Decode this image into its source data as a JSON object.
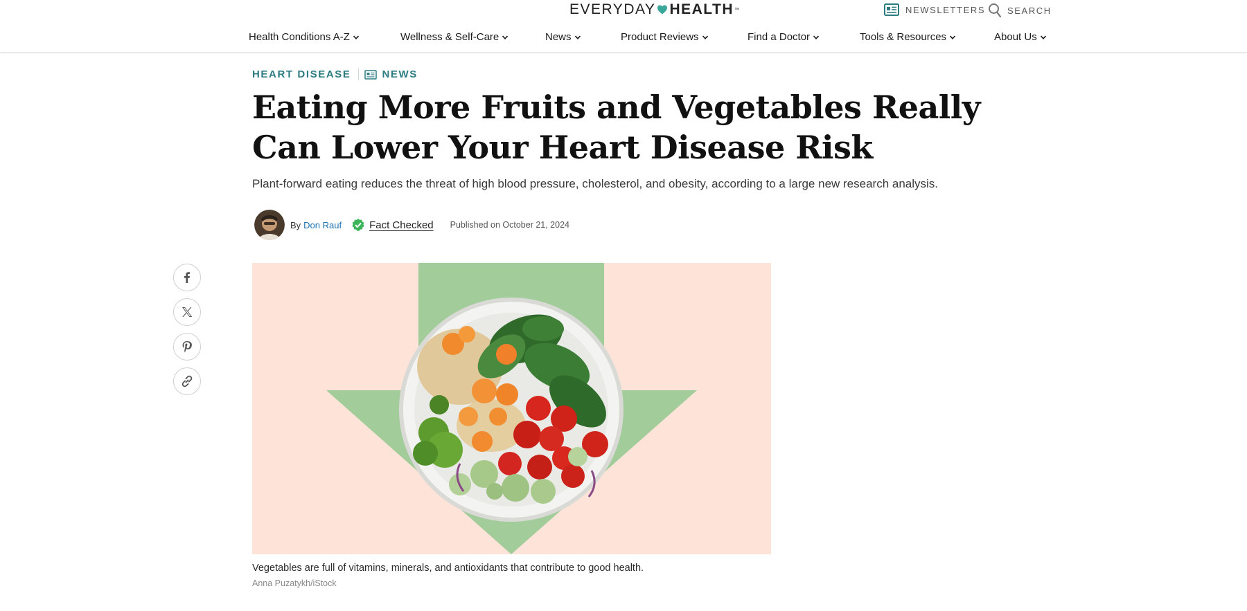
{
  "header": {
    "logo": {
      "part1": "EVERYDAY",
      "part2": "HEALTH",
      "tm": "™"
    },
    "newsletters_label": "NEWSLETTERS",
    "search_label": "SEARCH"
  },
  "nav": {
    "items": [
      {
        "label": "Health Conditions A-Z"
      },
      {
        "label": "Wellness & Self-Care"
      },
      {
        "label": "News"
      },
      {
        "label": "Product Reviews"
      },
      {
        "label": "Find a Doctor"
      },
      {
        "label": "Tools & Resources"
      },
      {
        "label": "About Us"
      }
    ]
  },
  "article": {
    "category": "HEART DISEASE",
    "type": "NEWS",
    "headline": "Eating More Fruits and Vegetables Really Can Lower Your Heart Disease Risk",
    "dek": "Plant-forward eating reduces the threat of high blood pressure, cholesterol, and obesity, according to a large new research analysis.",
    "byline_prefix": "By",
    "author": "Don Rauf",
    "fact_checked": "Fact Checked",
    "published": "Published on October 21, 2024",
    "image_caption": "Vegetables are full of vitamins, minerals, and antioxidants that contribute to good health.",
    "image_credit": "Anna Puzatykh/iStock"
  },
  "share": [
    "facebook-icon",
    "x-icon",
    "pinterest-icon",
    "link-icon"
  ],
  "colors": {
    "accent_teal": "#2c7b80",
    "link_blue": "#1c6fb0",
    "hero_background": "#fde3d8",
    "hero_arrow": "#a3cc9b",
    "fact_check_green": "#3cb45a"
  }
}
